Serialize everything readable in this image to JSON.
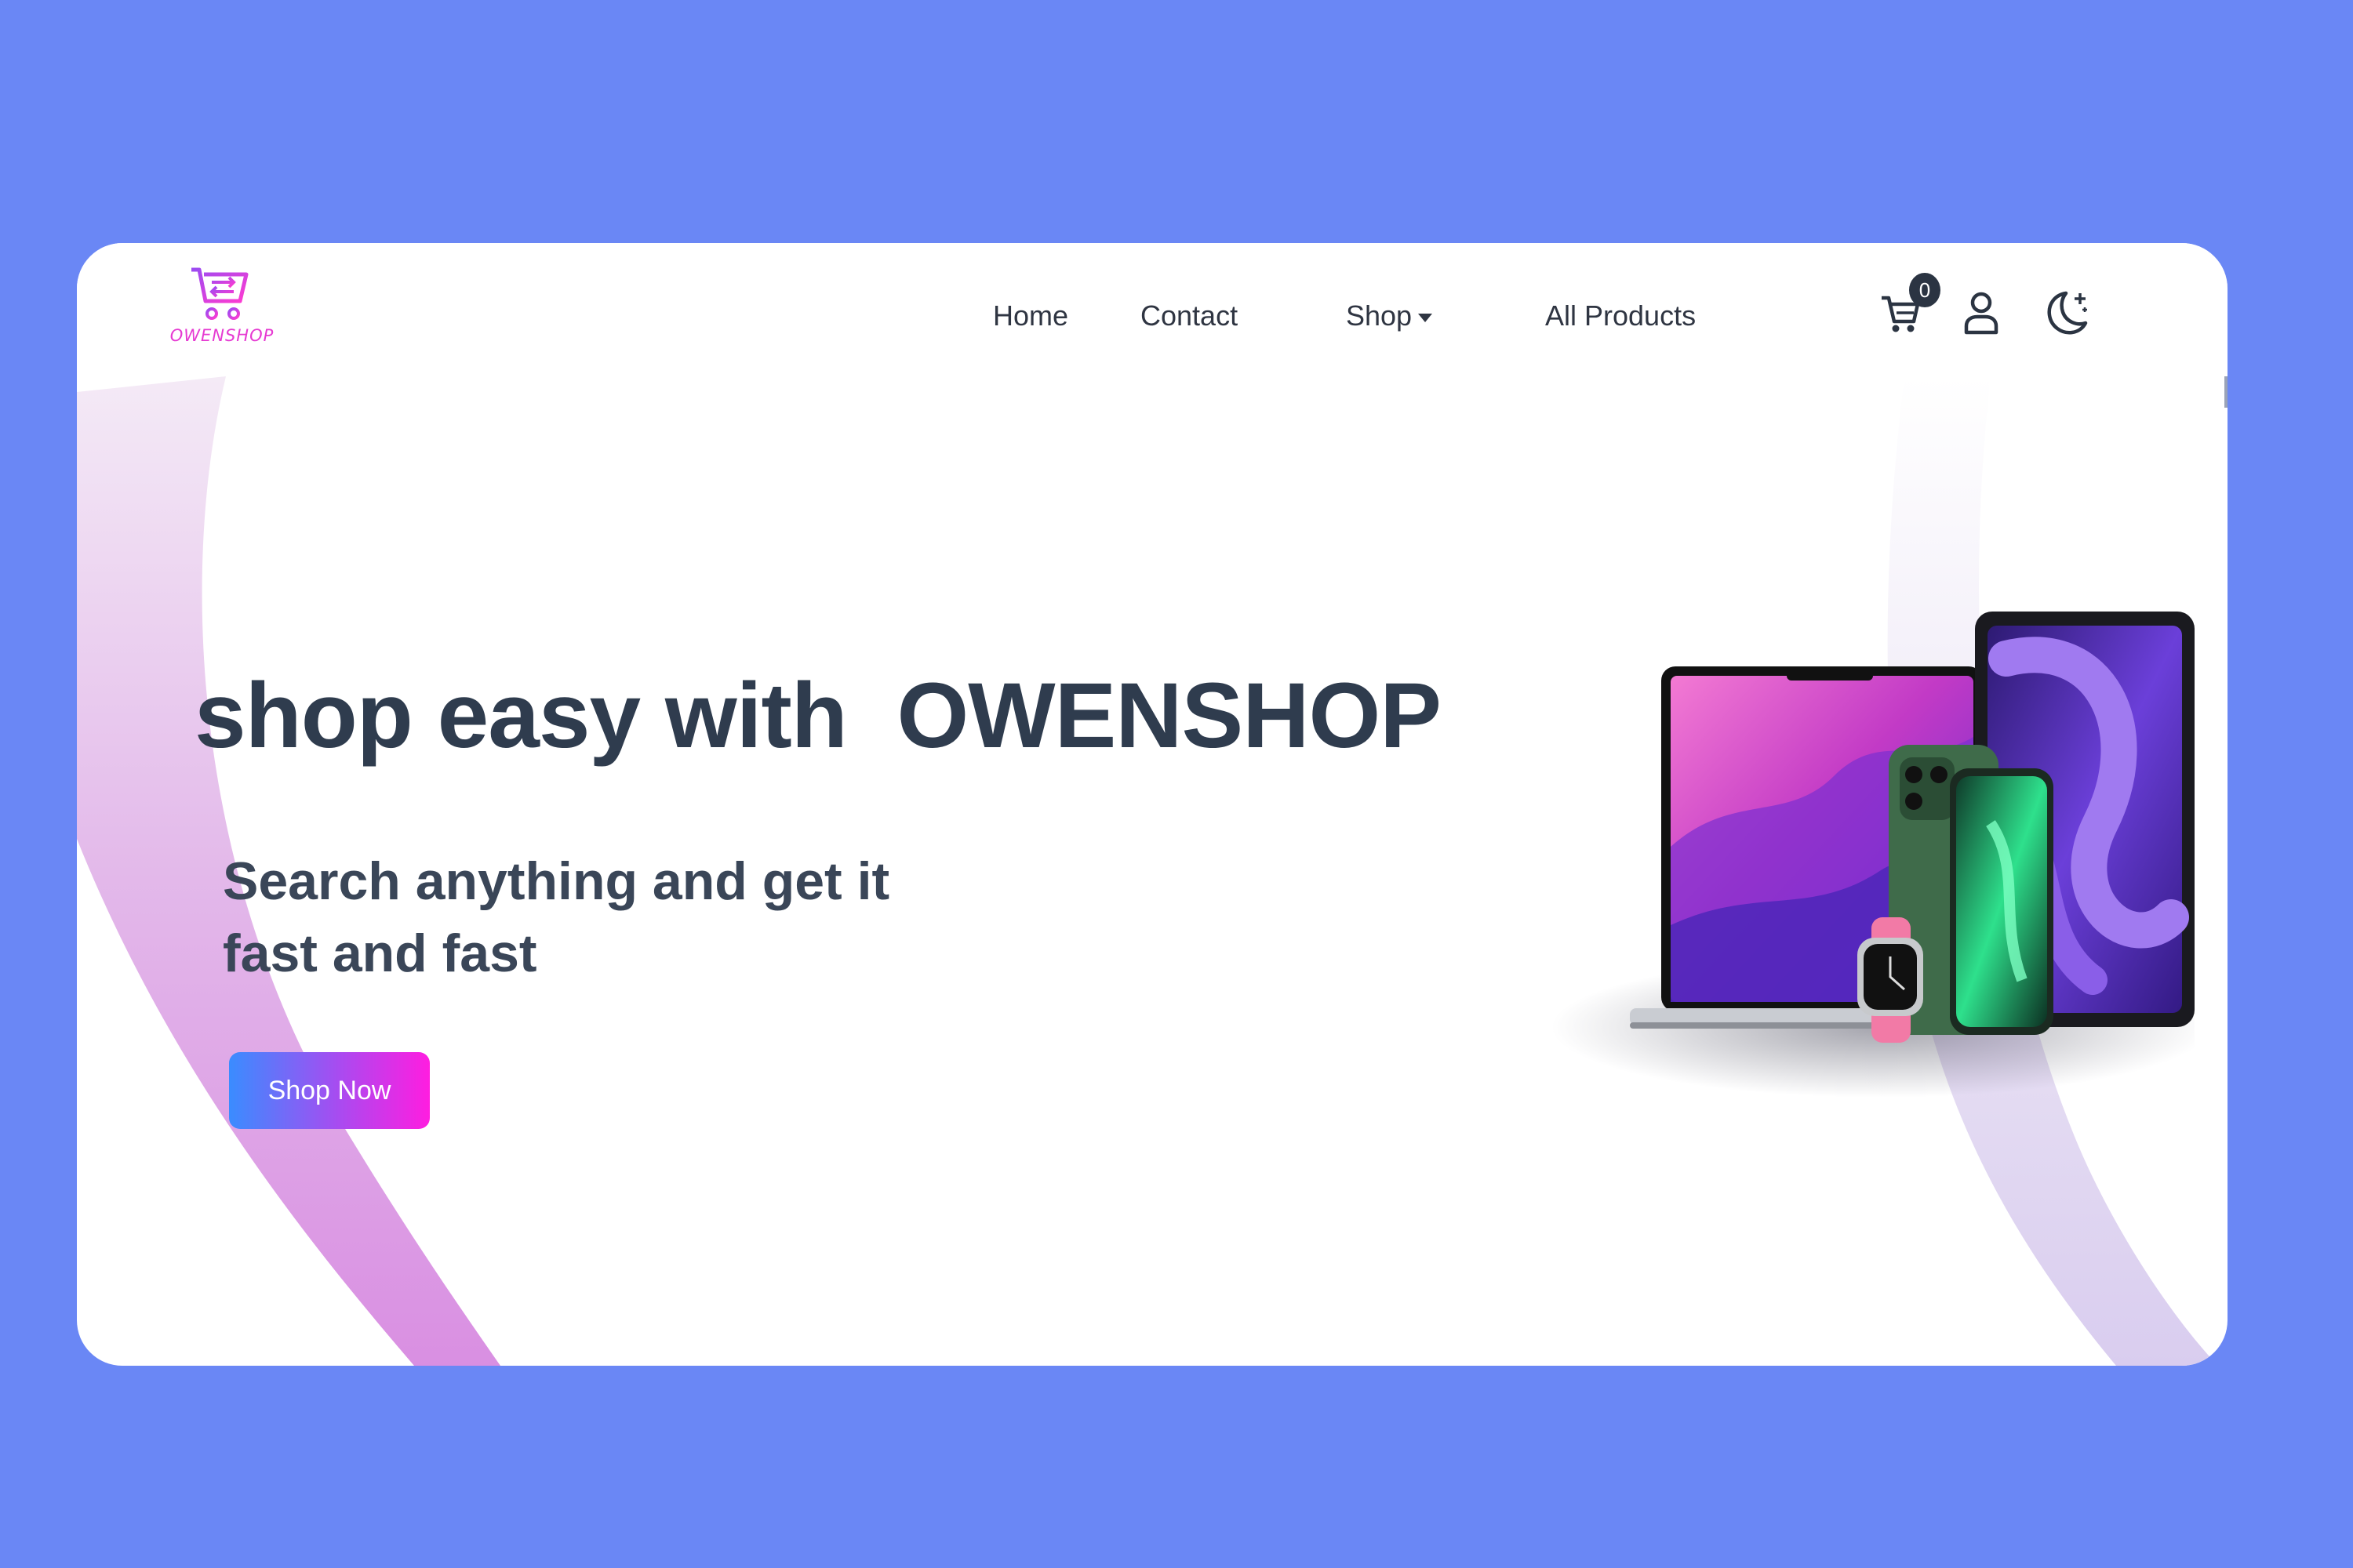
{
  "brand": {
    "logo_text": "OWENSHOP"
  },
  "nav": {
    "items": [
      {
        "label": "Home"
      },
      {
        "label": "Contact"
      },
      {
        "label": "Shop"
      },
      {
        "label": "All Products"
      }
    ]
  },
  "header_actions": {
    "cart_count": "0",
    "cart_icon": "cart-icon",
    "user_icon": "user-icon",
    "theme_icon": "moon-icon"
  },
  "hero": {
    "title": "shop easy with  OWENSHOP",
    "subtitle": "Search anything and get it fast and fast",
    "cta_label": "Shop Now"
  },
  "colors": {
    "background": "#6a87f5",
    "card": "#ffffff",
    "text_dark": "#2f3c4e",
    "accent_pink": "#ff1de0",
    "accent_blue": "#3a8cff"
  }
}
